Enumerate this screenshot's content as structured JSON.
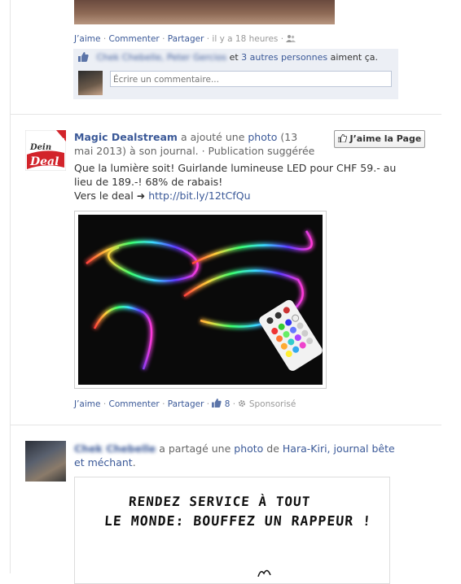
{
  "post1": {
    "actions": {
      "like": "J’aime",
      "comment": "Commenter",
      "share": "Partager",
      "time": "il y a 18 heures"
    },
    "likes": {
      "blurred_names": "Chek Chebelle, Peter Gercios",
      "and_text": " et ",
      "others_link": "3 autres personnes",
      "suffix": " aiment ça."
    },
    "comment_placeholder": "Écrire un commentaire..."
  },
  "post2": {
    "page_name": "Magic Dealstream",
    "added_text": " a ajouté une ",
    "photo_link": "photo",
    "date": " (13 mai 2013)",
    "to_journal": " à son journal.",
    "suggested": " · Publication suggérée",
    "like_page_button": "J’aime la Page",
    "text_line1": "Que la lumière soit! Guirlande lumineuse LED pour CHF 59.- au lieu de 189.-! 68% de rabais!",
    "deal_prefix": "Vers le deal ➜ ",
    "deal_url": "http://bit.ly/12tCfQu",
    "logo": {
      "line1": "Dein",
      "line2": "Deal"
    },
    "actions": {
      "like": "J’aime",
      "comment": "Commenter",
      "share": "Partager",
      "like_count": "8",
      "sponsored": "Sponsorisé"
    }
  },
  "post3": {
    "blurred_name": "Chek Chebelle",
    "shared_text": " a partagé une ",
    "photo_link": "photo",
    "of_text": " de ",
    "source_link": "Hara-Kiri, journal bête et méchant",
    "period": ".",
    "cartoon_line1": "RENDEZ SERVICE À TOUT",
    "cartoon_line2": "LE MONDE: BOUFFEZ UN RAPPEUR !"
  },
  "colors": {
    "link": "#3b5998",
    "meta": "#999999",
    "like_box": "#eceff5"
  }
}
